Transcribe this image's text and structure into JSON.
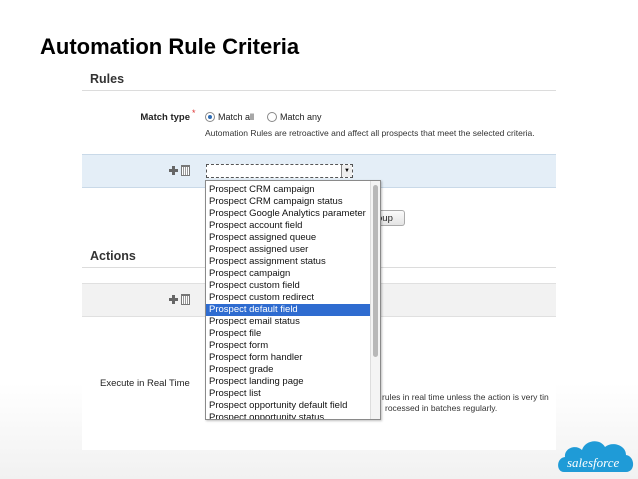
{
  "slide": {
    "title": "Automation Rule Criteria"
  },
  "rules": {
    "section_title": "Rules",
    "match_type": {
      "label": "Match type",
      "options": [
        "Match all",
        "Match any"
      ],
      "selected": "Match all",
      "hint": "Automation Rules are retroactive and affect all prospects that meet the selected criteria."
    },
    "criteria_select_value": "",
    "add_group_fragment": "oup"
  },
  "dropdown": {
    "selected": "Prospect default field",
    "options": [
      "Prospect CRM campaign",
      "Prospect CRM campaign status",
      "Prospect Google Analytics parameter",
      "Prospect account field",
      "Prospect assigned queue",
      "Prospect assigned user",
      "Prospect assignment status",
      "Prospect campaign",
      "Prospect custom field",
      "Prospect custom redirect",
      "Prospect default field",
      "Prospect email status",
      "Prospect file",
      "Prospect form",
      "Prospect form handler",
      "Prospect grade",
      "Prospect landing page",
      "Prospect list",
      "Prospect opportunity default field",
      "Prospect opportunity status"
    ]
  },
  "actions": {
    "section_title": "Actions",
    "execute_label": "Execute in Real Time",
    "execute_hint_line1": "rules in real time unless the action is very tin",
    "execute_hint_line2": "rocessed in batches regularly."
  },
  "branding": {
    "logo_text": "salesforce",
    "logo_color": "#1f9bd7"
  }
}
